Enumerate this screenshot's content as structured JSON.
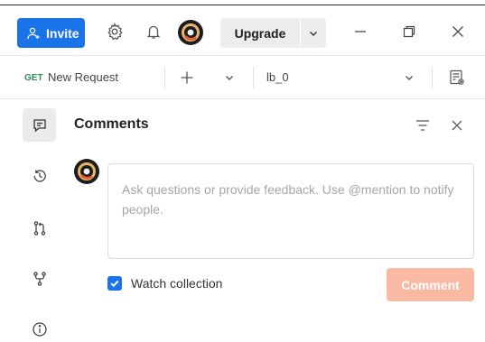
{
  "titlebar": {
    "invite_label": "Invite",
    "upgrade_label": "Upgrade",
    "icons": [
      "add-user-icon",
      "gear-icon",
      "bell-icon",
      "avatar",
      "chevron-down-icon",
      "minimize-icon",
      "restore-icon",
      "close-icon"
    ]
  },
  "request": {
    "method": "GET",
    "name": "New Request",
    "environment": "lb_0"
  },
  "sidebar": {
    "items": [
      {
        "name": "comments",
        "icon": "comment-icon",
        "active": true
      },
      {
        "name": "history",
        "icon": "history-icon",
        "active": false
      },
      {
        "name": "pull-requests",
        "icon": "pull-request-icon",
        "active": false
      },
      {
        "name": "forks",
        "icon": "fork-icon",
        "active": false
      },
      {
        "name": "info",
        "icon": "info-icon",
        "active": false
      }
    ]
  },
  "comments": {
    "title": "Comments",
    "placeholder": "Ask questions or provide feedback. Use @mention to notify people.",
    "watch_label": "Watch collection",
    "watch_checked": true,
    "submit_label": "Comment"
  },
  "colors": {
    "accent": "#1a73e8",
    "comment_button": "#f9b9a2",
    "method_get": "#2e8b57"
  }
}
